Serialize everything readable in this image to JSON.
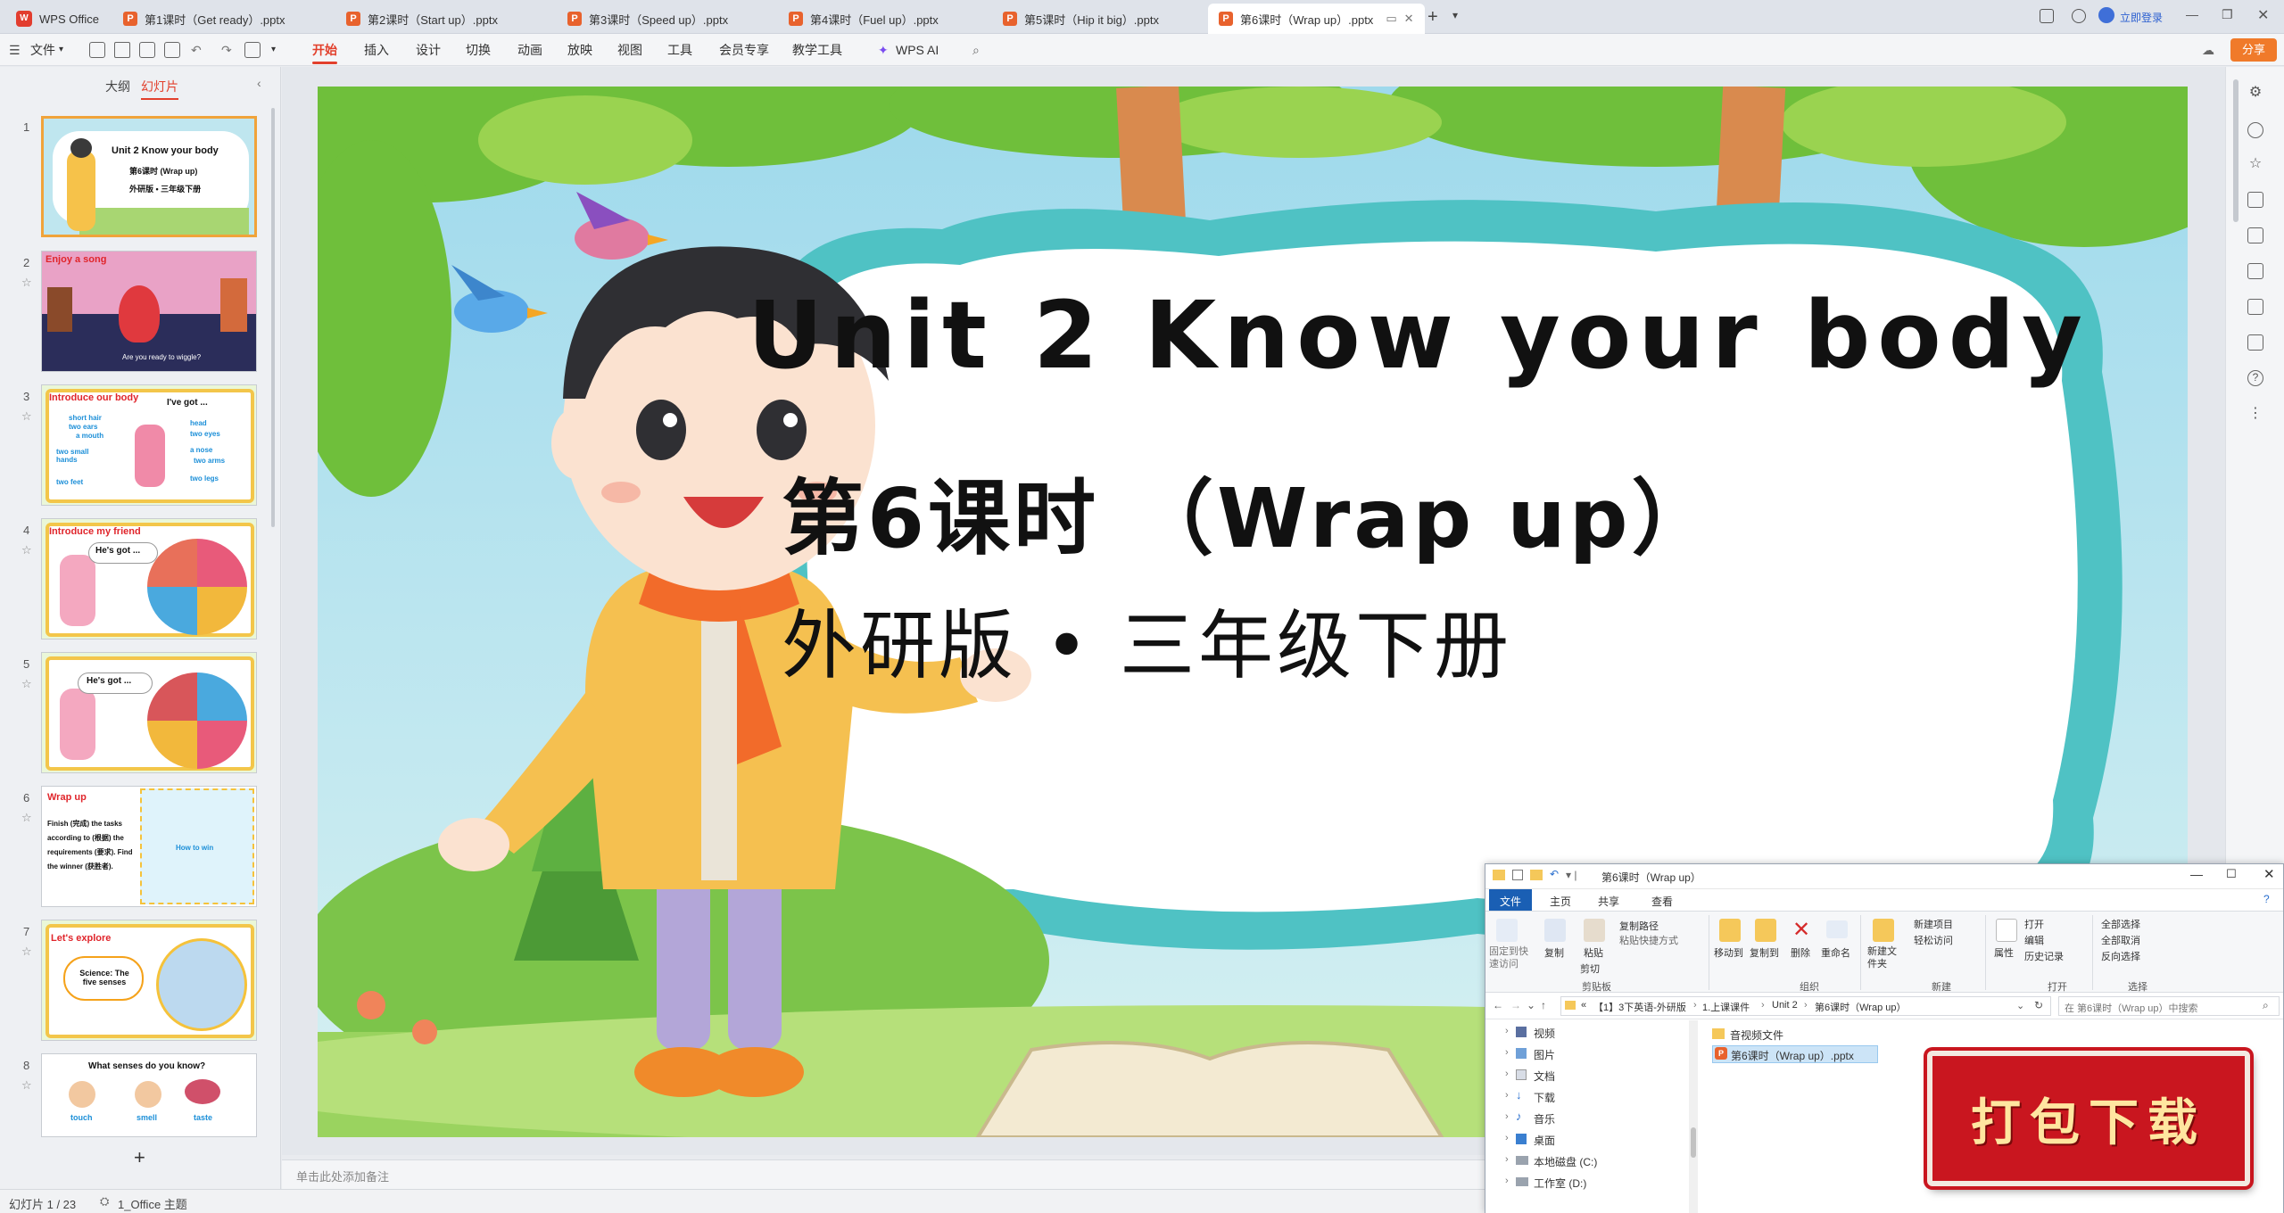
{
  "app": {
    "name": "WPS Office"
  },
  "tabs": [
    {
      "label": "第1课时（Get ready）.pptx"
    },
    {
      "label": "第2课时（Start up）.pptx"
    },
    {
      "label": "第3课时（Speed up）.pptx"
    },
    {
      "label": "第4课时（Fuel up）.pptx"
    },
    {
      "label": "第5课时（Hip it big）.pptx"
    },
    {
      "label": "第6课时（Wrap up）.pptx"
    }
  ],
  "titlebar": {
    "login": "立即登录",
    "share": "分享"
  },
  "menu": {
    "file": "文件",
    "items": [
      "开始",
      "插入",
      "设计",
      "切换",
      "动画",
      "放映",
      "视图",
      "工具",
      "会员专享",
      "教学工具",
      "WPS AI"
    ]
  },
  "leftpanel": {
    "tab_outline": "大纲",
    "tab_slides": "幻灯片",
    "add": "+",
    "slides": [
      {
        "num": "1",
        "title": "Unit 2 Know your body",
        "sub1": "第6课时 (Wrap up)",
        "sub2": "外研版 • 三年级下册"
      },
      {
        "num": "2",
        "title": "Enjoy a song",
        "caption": "Are you ready to wiggle?"
      },
      {
        "num": "3",
        "title": "Introduce our body",
        "bubble": "I've got ...",
        "labels": [
          "short hair",
          "two ears",
          "a mouth",
          "two small hands",
          "two feet",
          "head",
          "two eyes",
          "a nose",
          "two arms",
          "two legs"
        ]
      },
      {
        "num": "4",
        "title": "Introduce my friend",
        "bubble": "He's got ..."
      },
      {
        "num": "5",
        "bubble": "He's got ..."
      },
      {
        "num": "6",
        "title": "Wrap up",
        "body": "Finish (完成) the tasks according to (根据) the requirements (要求). Find the winner (获胜者).",
        "extra": "How to win"
      },
      {
        "num": "7",
        "title": "Let's explore",
        "bubble": "Science: The five senses"
      },
      {
        "num": "8",
        "title": "What senses do you know?",
        "labels": [
          "touch",
          "smell",
          "taste"
        ]
      }
    ]
  },
  "slide": {
    "title": "Unit 2 Know your body",
    "subtitle": "第6课时 （Wrap up）",
    "publisher": "外研版 • 三年级下册"
  },
  "notes": {
    "placeholder": "单击此处添加备注"
  },
  "status": {
    "slide_count": "幻灯片 1 / 23",
    "theme": "1_Office 主题"
  },
  "explorer": {
    "title": "第6课时（Wrap up）",
    "ribbon_tabs": [
      "文件",
      "主页",
      "共享",
      "查看"
    ],
    "groups": {
      "clipboard": {
        "label": "剪贴板",
        "pin": "固定到快速访问",
        "copy": "复制",
        "paste": "粘贴",
        "copy_path": "复制路径",
        "paste_shortcut": "粘贴快捷方式",
        "cut": "剪切"
      },
      "organize": {
        "label": "组织",
        "move_to": "移动到",
        "copy_to": "复制到",
        "delete": "删除",
        "rename": "重命名"
      },
      "new": {
        "label": "新建",
        "new_folder": "新建文件夹",
        "new_item": "新建项目",
        "easy_access": "轻松访问"
      },
      "open": {
        "label": "打开",
        "open": "打开",
        "edit": "编辑",
        "history": "历史记录",
        "properties": "属性"
      },
      "select": {
        "label": "选择",
        "select_all": "全部选择",
        "select_none": "全部取消",
        "invert": "反向选择"
      }
    },
    "breadcrumb": [
      "«",
      "【1】3下英语-外研版",
      "1.上课课件",
      "Unit 2",
      "第6课时（Wrap up）"
    ],
    "search_placeholder": "在 第6课时（Wrap up）中搜索",
    "nav": [
      "视频",
      "图片",
      "文档",
      "下载",
      "音乐",
      "桌面",
      "本地磁盘 (C:)",
      "工作室 (D:)"
    ],
    "files": [
      "音视频文件",
      "第6课时（Wrap up）.pptx"
    ]
  },
  "banner": {
    "text": "打包下载"
  },
  "colors": {
    "accent": "#e2402c",
    "ppt": "#e8622d",
    "banner": "#c9161f"
  }
}
